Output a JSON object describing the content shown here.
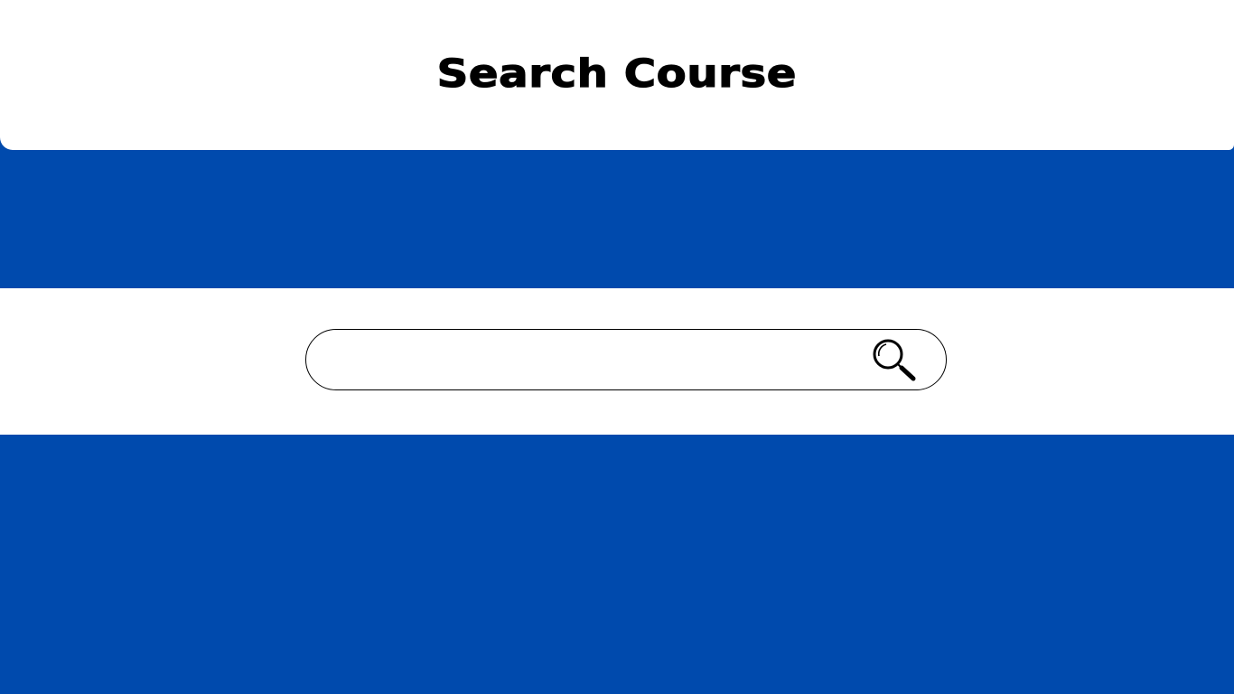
{
  "header": {
    "title": "Search Course"
  },
  "search": {
    "value": "",
    "placeholder": "",
    "button_icon": "search-icon"
  },
  "colors": {
    "brand_blue": "#004aad",
    "panel_white": "#ffffff",
    "text": "#000000"
  }
}
